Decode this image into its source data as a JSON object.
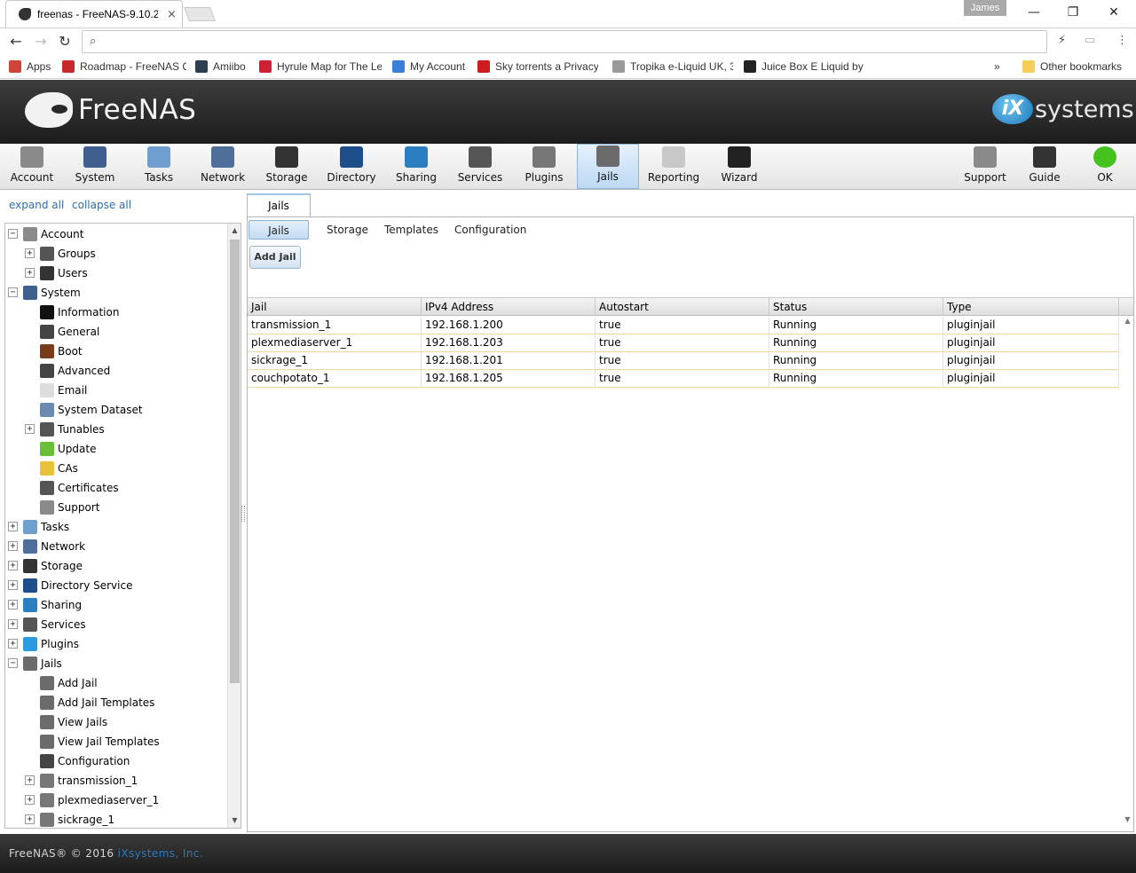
{
  "browser": {
    "tab_title": "freenas - FreeNAS-9.10.2",
    "tab_close": "×",
    "user_badge": "James",
    "controls": {
      "minimize": "—",
      "maximize": "❐",
      "close": "✕"
    },
    "address_value": "",
    "bookmarks": [
      {
        "label": "Apps",
        "color": "#d04437"
      },
      {
        "label": "Roadmap - FreeNAS C",
        "color": "#c62a2a"
      },
      {
        "label": "Amiibo",
        "color": "#2c3e50"
      },
      {
        "label": "Hyrule Map for The Le",
        "color": "#cc2233"
      },
      {
        "label": "My Account",
        "color": "#3a7fd5"
      },
      {
        "label": "Sky torrents a Privacy",
        "color": "#cc1c1c"
      },
      {
        "label": "Tropika e-Liquid UK, 3",
        "color": "#999999"
      },
      {
        "label": "Juice Box E Liquid by C",
        "color": "#222222"
      }
    ],
    "bookmarks_overflow": "»",
    "other_bookmarks": "Other bookmarks"
  },
  "header": {
    "brand": "FreeNAS",
    "partner_logo_ix": "iX",
    "partner_logo_text": "systems"
  },
  "toolbar": {
    "items": [
      {
        "label": "Account",
        "icon": "account-icon",
        "color": "#8a8a8a"
      },
      {
        "label": "System",
        "icon": "system-icon",
        "color": "#3f5f8f"
      },
      {
        "label": "Tasks",
        "icon": "tasks-icon",
        "color": "#6f9fcf"
      },
      {
        "label": "Network",
        "icon": "network-icon",
        "color": "#4d6f99"
      },
      {
        "label": "Storage",
        "icon": "storage-icon",
        "color": "#333333"
      },
      {
        "label": "Directory",
        "icon": "directory-icon",
        "color": "#1d4e89"
      },
      {
        "label": "Sharing",
        "icon": "sharing-icon",
        "color": "#2b7fc0"
      },
      {
        "label": "Services",
        "icon": "services-icon",
        "color": "#555555"
      },
      {
        "label": "Plugins",
        "icon": "plugins-icon",
        "color": "#777777"
      },
      {
        "label": "Jails",
        "icon": "jails-icon",
        "color": "#6b6b6b"
      },
      {
        "label": "Reporting",
        "icon": "reporting-icon",
        "color": "#c8c8c8"
      },
      {
        "label": "Wizard",
        "icon": "wizard-icon",
        "color": "#222222"
      }
    ],
    "right_items": [
      {
        "label": "Support",
        "icon": "support-icon",
        "color": "#8a8a8a"
      },
      {
        "label": "Guide",
        "icon": "guide-icon",
        "color": "#333333"
      },
      {
        "label": "OK",
        "icon": "ok-status-icon",
        "color": "#46c21e"
      }
    ],
    "active": "Jails"
  },
  "left": {
    "expand_all": "expand all",
    "collapse_all": "collapse all",
    "tree": [
      {
        "label": "Account",
        "level": 0,
        "toggle": "−",
        "icon": "account-icon",
        "color": "#8a8a8a"
      },
      {
        "label": "Groups",
        "level": 1,
        "toggle": "+",
        "icon": "groups-icon",
        "color": "#555555"
      },
      {
        "label": "Users",
        "level": 1,
        "toggle": "+",
        "icon": "user-icon",
        "color": "#333333"
      },
      {
        "label": "System",
        "level": 0,
        "toggle": "−",
        "icon": "system-icon",
        "color": "#3f5f8f"
      },
      {
        "label": "Information",
        "level": 1,
        "toggle": "",
        "icon": "information-icon",
        "color": "#111111"
      },
      {
        "label": "General",
        "level": 1,
        "toggle": "",
        "icon": "wrench-icon",
        "color": "#444444"
      },
      {
        "label": "Boot",
        "level": 1,
        "toggle": "",
        "icon": "boot-icon",
        "color": "#7a3d1a"
      },
      {
        "label": "Advanced",
        "level": 1,
        "toggle": "",
        "icon": "wrench-icon",
        "color": "#444444"
      },
      {
        "label": "Email",
        "level": 1,
        "toggle": "",
        "icon": "email-icon",
        "color": "#dddddd"
      },
      {
        "label": "System Dataset",
        "level": 1,
        "toggle": "",
        "icon": "dataset-icon",
        "color": "#6b8ab0"
      },
      {
        "label": "Tunables",
        "level": 1,
        "toggle": "+",
        "icon": "tunables-icon",
        "color": "#555555"
      },
      {
        "label": "Update",
        "level": 1,
        "toggle": "",
        "icon": "update-icon",
        "color": "#6abf3a"
      },
      {
        "label": "CAs",
        "level": 1,
        "toggle": "",
        "icon": "ca-icon",
        "color": "#e8c23a"
      },
      {
        "label": "Certificates",
        "level": 1,
        "toggle": "",
        "icon": "certificate-icon",
        "color": "#555555"
      },
      {
        "label": "Support",
        "level": 1,
        "toggle": "",
        "icon": "support-icon",
        "color": "#8a8a8a"
      },
      {
        "label": "Tasks",
        "level": 0,
        "toggle": "+",
        "icon": "tasks-icon",
        "color": "#6f9fcf"
      },
      {
        "label": "Network",
        "level": 0,
        "toggle": "+",
        "icon": "network-icon",
        "color": "#4d6f99"
      },
      {
        "label": "Storage",
        "level": 0,
        "toggle": "+",
        "icon": "storage-icon",
        "color": "#333333"
      },
      {
        "label": "Directory Service",
        "level": 0,
        "toggle": "+",
        "icon": "directory-icon",
        "color": "#1d4e89"
      },
      {
        "label": "Sharing",
        "level": 0,
        "toggle": "+",
        "icon": "sharing-icon",
        "color": "#2b7fc0"
      },
      {
        "label": "Services",
        "level": 0,
        "toggle": "+",
        "icon": "services-icon",
        "color": "#555555"
      },
      {
        "label": "Plugins",
        "level": 0,
        "toggle": "+",
        "icon": "plugins-icon",
        "color": "#2b9be0"
      },
      {
        "label": "Jails",
        "level": 0,
        "toggle": "−",
        "icon": "jails-icon",
        "color": "#6b6b6b"
      },
      {
        "label": "Add Jail",
        "level": 1,
        "toggle": "",
        "icon": "jails-icon",
        "color": "#6b6b6b"
      },
      {
        "label": "Add Jail Templates",
        "level": 1,
        "toggle": "",
        "icon": "jails-icon",
        "color": "#6b6b6b"
      },
      {
        "label": "View Jails",
        "level": 1,
        "toggle": "",
        "icon": "jails-icon",
        "color": "#6b6b6b"
      },
      {
        "label": "View Jail Templates",
        "level": 1,
        "toggle": "",
        "icon": "jails-icon",
        "color": "#6b6b6b"
      },
      {
        "label": "Configuration",
        "level": 1,
        "toggle": "",
        "icon": "wrench-icon",
        "color": "#444444"
      },
      {
        "label": "transmission_1",
        "level": 1,
        "toggle": "+",
        "icon": "plugin-jail-icon",
        "color": "#777777"
      },
      {
        "label": "plexmediaserver_1",
        "level": 1,
        "toggle": "+",
        "icon": "plugin-jail-icon",
        "color": "#777777"
      },
      {
        "label": "sickrage_1",
        "level": 1,
        "toggle": "+",
        "icon": "plugin-jail-icon",
        "color": "#777777"
      }
    ]
  },
  "main": {
    "outer_tab": "Jails",
    "subtabs": [
      "Jails",
      "Storage",
      "Templates",
      "Configuration"
    ],
    "active_subtab": "Jails",
    "add_button": "Add Jail",
    "table": {
      "columns": [
        "Jail",
        "IPv4 Address",
        "Autostart",
        "Status",
        "Type"
      ],
      "rows": [
        [
          "transmission_1",
          "192.168.1.200",
          "true",
          "Running",
          "pluginjail"
        ],
        [
          "plexmediaserver_1",
          "192.168.1.203",
          "true",
          "Running",
          "pluginjail"
        ],
        [
          "sickrage_1",
          "192.168.1.201",
          "true",
          "Running",
          "pluginjail"
        ],
        [
          "couchpotato_1",
          "192.168.1.205",
          "true",
          "Running",
          "pluginjail"
        ]
      ]
    }
  },
  "footer": {
    "copyright": "FreeNAS® © 2016 ",
    "company": "iXsystems, Inc."
  }
}
